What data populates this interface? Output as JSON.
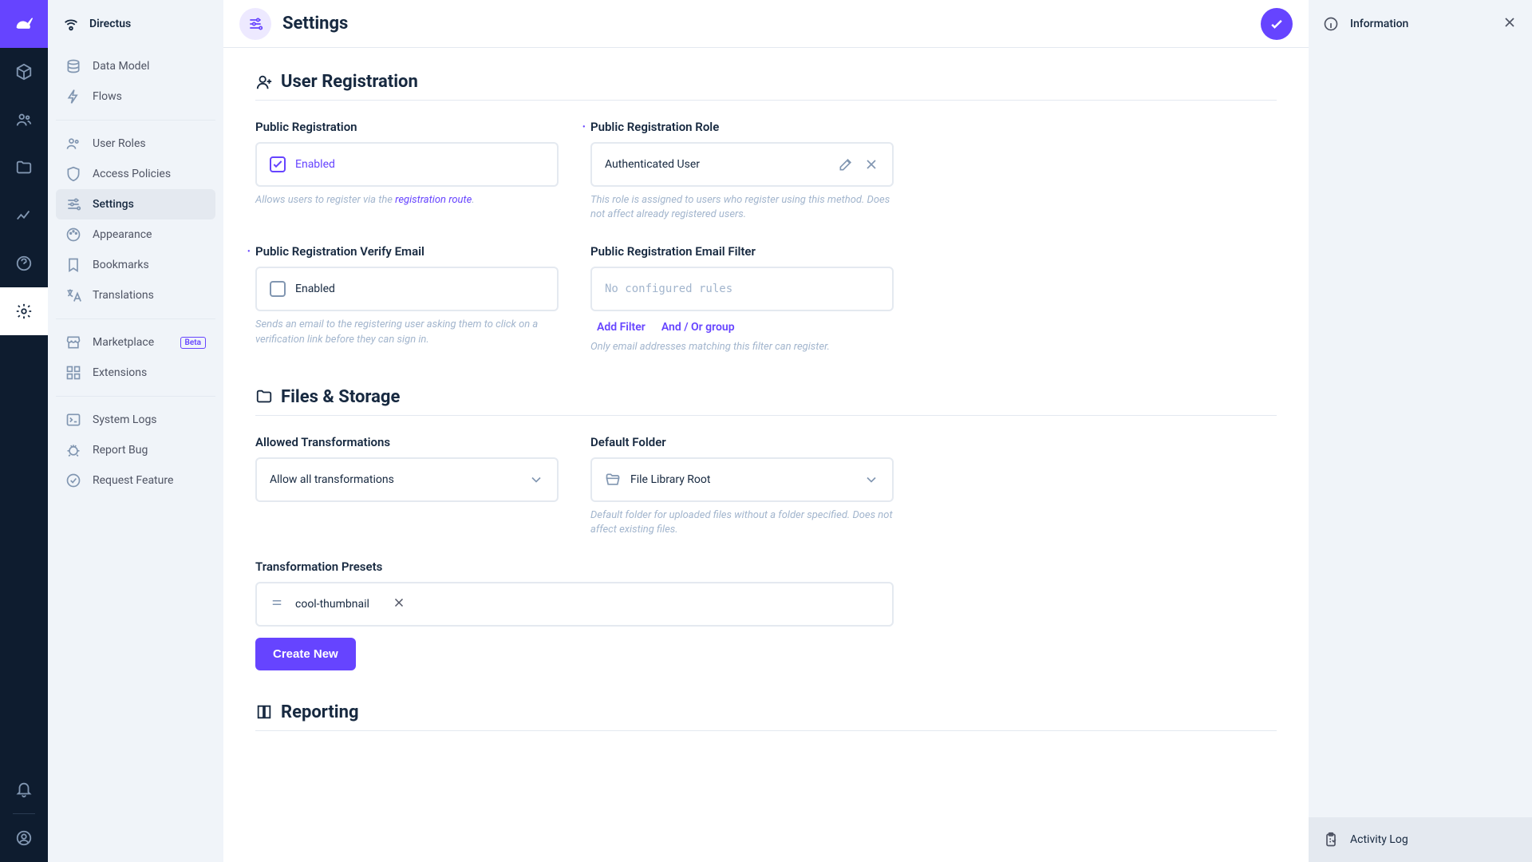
{
  "brand": "Directus",
  "header": {
    "title": "Settings"
  },
  "right_sidebar": {
    "title": "Information",
    "footer": "Activity Log"
  },
  "nav": {
    "items": [
      {
        "label": "Data Model"
      },
      {
        "label": "Flows"
      },
      {
        "label": "User Roles"
      },
      {
        "label": "Access Policies"
      },
      {
        "label": "Settings"
      },
      {
        "label": "Appearance"
      },
      {
        "label": "Bookmarks"
      },
      {
        "label": "Translations"
      },
      {
        "label": "Marketplace",
        "badge": "Beta"
      },
      {
        "label": "Extensions"
      },
      {
        "label": "System Logs"
      },
      {
        "label": "Report Bug"
      },
      {
        "label": "Request Feature"
      }
    ]
  },
  "sections": {
    "user_reg": {
      "title": "User Registration",
      "public_reg": {
        "label": "Public Registration",
        "value": "Enabled",
        "hint_prefix": "Allows users to register via the ",
        "hint_link": "registration route",
        "hint_suffix": "."
      },
      "role": {
        "label": "Public Registration Role",
        "value": "Authenticated User",
        "hint": "This role is assigned to users who register using this method. Does not affect already registered users."
      },
      "verify": {
        "label": "Public Registration Verify Email",
        "value": "Enabled",
        "hint": "Sends an email to the registering user asking them to click on a verification link before they can sign in."
      },
      "filter": {
        "label": "Public Registration Email Filter",
        "placeholder": "No configured rules",
        "add_filter": "Add Filter",
        "and_or": "And / Or group",
        "hint": "Only email addresses matching this filter can register."
      }
    },
    "files": {
      "title": "Files & Storage",
      "transforms": {
        "label": "Allowed Transformations",
        "value": "Allow all transformations"
      },
      "default_folder": {
        "label": "Default Folder",
        "value": "File Library Root",
        "hint": "Default folder for uploaded files without a folder specified. Does not affect existing files."
      },
      "presets": {
        "label": "Transformation Presets",
        "items": [
          "cool-thumbnail"
        ],
        "create": "Create New"
      }
    },
    "reporting": {
      "title": "Reporting"
    }
  }
}
